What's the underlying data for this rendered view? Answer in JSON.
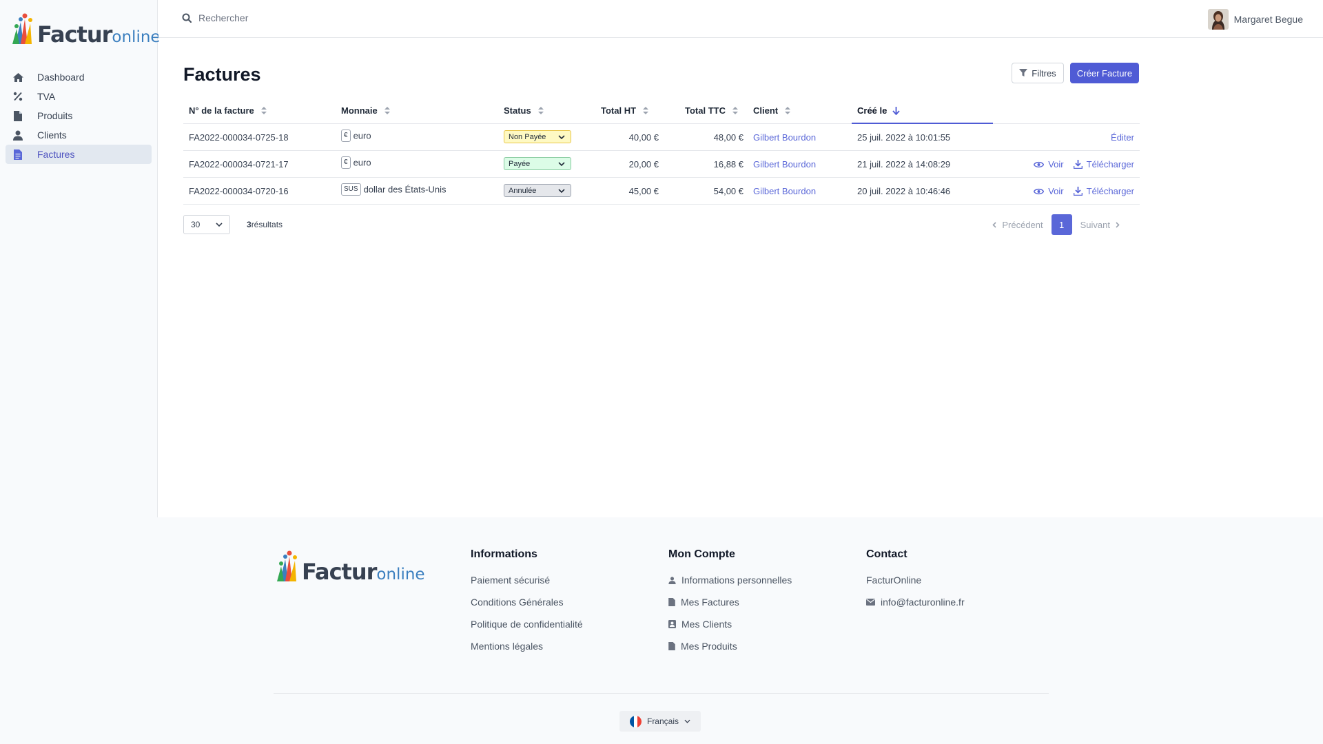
{
  "brand": {
    "name_main": "Factur",
    "name_sub": "online"
  },
  "sidebar": {
    "items": [
      {
        "label": "Dashboard",
        "icon": "home-icon"
      },
      {
        "label": "TVA",
        "icon": "percent-icon"
      },
      {
        "label": "Produits",
        "icon": "file-icon"
      },
      {
        "label": "Clients",
        "icon": "user-icon"
      },
      {
        "label": "Factures",
        "icon": "invoice-icon",
        "active": true
      }
    ]
  },
  "topbar": {
    "search_placeholder": "Rechercher",
    "user_name": "Margaret Begue"
  },
  "main": {
    "title": "Factures",
    "filter_label": "Filtres",
    "create_label": "Créer Facture",
    "columns": [
      "N° de la facture",
      "Monnaie",
      "Status",
      "Total HT",
      "Total TTC",
      "Client",
      "Créé le"
    ],
    "sorted_column": "Créé le",
    "rows": [
      {
        "number": "FA2022-000034-0725-18",
        "currency_symbol": "€",
        "currency": "euro",
        "status": "Non Payée",
        "status_type": "unpaid",
        "total_ht": "40,00 €",
        "total_ttc": "48,00 €",
        "client": "Gilbert Bourdon",
        "created": "25 juil. 2022 à 10:01:55",
        "actions": {
          "edit": "Éditer"
        }
      },
      {
        "number": "FA2022-000034-0721-17",
        "currency_symbol": "€",
        "currency": "euro",
        "status": "Payée",
        "status_type": "paid",
        "total_ht": "20,00 €",
        "total_ttc": "16,88 €",
        "client": "Gilbert Bourdon",
        "created": "21 juil. 2022 à 14:08:29",
        "actions": {
          "view": "Voir",
          "download": "Télécharger"
        }
      },
      {
        "number": "FA2022-000034-0720-16",
        "currency_symbol": "SUS",
        "currency": "dollar des États-Unis",
        "status": "Annulée",
        "status_type": "cancelled",
        "total_ht": "45,00 €",
        "total_ttc": "54,00 €",
        "client": "Gilbert Bourdon",
        "created": "20 juil. 2022 à 10:46:46",
        "actions": {
          "view": "Voir",
          "download": "Télécharger"
        }
      }
    ],
    "per_page": "30",
    "results_count": "3",
    "results_label": "résultats",
    "pagination": {
      "prev": "Précédent",
      "current": "1",
      "next": "Suivant"
    }
  },
  "footer": {
    "informations": {
      "title": "Informations",
      "links": [
        "Paiement sécurisé",
        "Conditions Générales",
        "Politique de confidentialité",
        "Mentions légales"
      ]
    },
    "account": {
      "title": "Mon Compte",
      "links": [
        "Informations personnelles",
        "Mes Factures",
        "Mes Clients",
        "Mes Produits"
      ]
    },
    "contact": {
      "title": "Contact",
      "company": "FacturOnline",
      "email": "info@facturonline.fr"
    },
    "language": "Français"
  },
  "colors": {
    "accent": "#4f5bd5",
    "link": "#5a67d8",
    "unpaid_bg": "#fef9c3",
    "paid_bg": "#dcfce7",
    "cancelled_bg": "#e5e7eb"
  }
}
